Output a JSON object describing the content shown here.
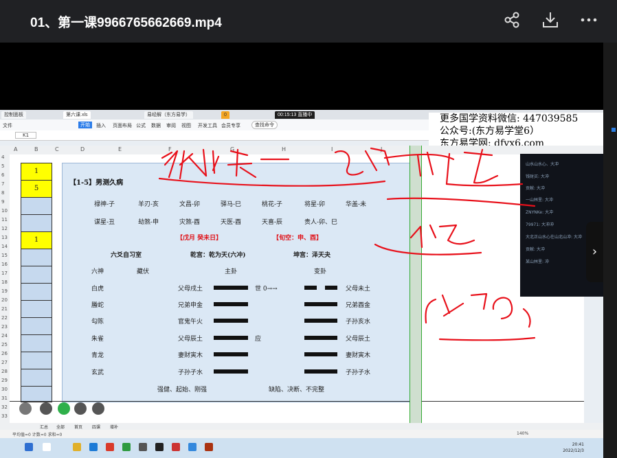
{
  "header": {
    "title": "01、第一课9966765662669.mp4",
    "share_icon": "share-icon",
    "download_icon": "download-icon",
    "more_icon": "more-icon"
  },
  "video": {
    "watermark": {
      "line1": "更多国学资料微信: 447039585",
      "line2": "公众号:(东方易学堂6）",
      "line3": "东方易学网: dfyx6.com"
    },
    "app_tabs": [
      "控制面板",
      "第六课.xls",
      "易经解（东方易学）",
      "0",
      "00:15:13 直播中"
    ],
    "menu": [
      "文件",
      "开始",
      "插入",
      "页面布局",
      "公式",
      "数据",
      "审阅",
      "视图",
      "开发工具",
      "会员专享"
    ],
    "search_placeholder": "查找命令",
    "cell_ref": "K1",
    "columns": [
      "A",
      "B",
      "C",
      "D",
      "E",
      "F",
      "G",
      "H",
      "I",
      "J",
      "K"
    ],
    "rows": [
      "4",
      "5",
      "6",
      "7",
      "8",
      "9",
      "10",
      "11",
      "12",
      "13",
      "14",
      "15",
      "16",
      "17",
      "18",
      "19",
      "20",
      "21",
      "22",
      "23",
      "24",
      "25",
      "26",
      "27",
      "28",
      "29",
      "30",
      "31",
      "32",
      "33"
    ],
    "b_column": [
      "1",
      "5",
      "",
      "",
      "1"
    ],
    "sheet": {
      "title": "【1-5】男测久病",
      "stars_row1": [
        "禄神-子",
        "羊刃-亥",
        "文昌-卯",
        "驿马-巳",
        "桃花-子",
        "将星-卯",
        "华盖-未"
      ],
      "stars_row2": [
        "谋星-丑",
        "劫煞-申",
        "灾煞-酉",
        "天医-酉",
        "天喜-辰",
        "贵人-卯、巳"
      ],
      "date_label": "【戊月     癸未日】",
      "void_label": "【旬空：申、酉】",
      "liuyao_header": "六爻自习室",
      "gong_header": "乾宫：乾为天(六冲)",
      "kun_header": "坤宫：泽天夬",
      "col_liushen": "六神",
      "col_fufu": "藏伏",
      "col_zhugua": "主卦",
      "col_biangua": "变卦",
      "lines": [
        {
          "shen": "白虎",
          "zhu": "父母戌土",
          "shi": "世 0→→",
          "bian": "父母未土"
        },
        {
          "shen": "螣蛇",
          "zhu": "兄弟申金",
          "shi": "",
          "bian": "兄弟酉金"
        },
        {
          "shen": "勾陈",
          "zhu": "官鬼午火",
          "shi": "",
          "bian": "子孙亥水"
        },
        {
          "shen": "朱雀",
          "zhu": "父母辰土",
          "shi": "应",
          "bian": "父母辰土"
        },
        {
          "shen": "青龙",
          "zhu": "妻财寅木",
          "shi": "",
          "bian": "妻财寅木"
        },
        {
          "shen": "玄武",
          "zhu": "子孙子水",
          "shi": "",
          "bian": "子孙子水"
        }
      ],
      "footer_left": "强健、起始、刚强",
      "footer_right": "缺陷、决断、不完整"
    },
    "chat": [
      "山水山水心、大冲",
      "钱财买: 大冲",
      "贡献: 大冲",
      "一山林里: 大冲",
      "ZNYNKe: 大冲",
      "79971: 大冲冲",
      "大北正山水心在山北山冲: 大冲",
      "贡献: 大冲",
      "某山林里: 冲"
    ],
    "sheet_tabs": [
      "汇总",
      "全部",
      "首页",
      "四课",
      "增补"
    ],
    "status_left": "平均值=0  计数=0  求和=0",
    "zoom": "140%",
    "clock_time": "20:41",
    "clock_date": "2022/12/3"
  },
  "handwriting": [
    "依林、鍾",
    "已冲",
    "六冲",
    "化退",
    "(人去意)"
  ]
}
